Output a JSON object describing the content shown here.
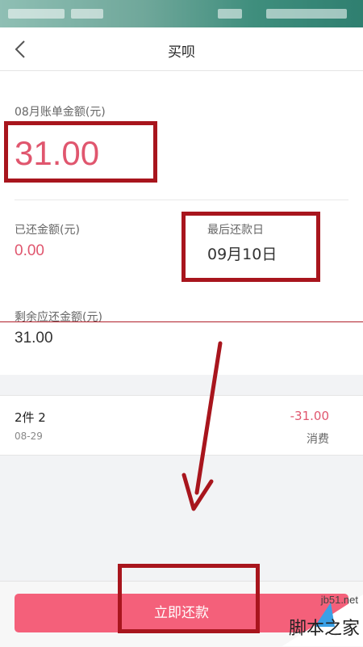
{
  "nav": {
    "title": "买呗",
    "back_icon": "chevron-left-icon"
  },
  "bill": {
    "month_label": "08月账单金额(元)",
    "amount": "31.00",
    "paid_label": "已还金额(元)",
    "paid_amount": "0.00",
    "due_label": "最后还款日",
    "due_date": "09月10日",
    "remaining_label": "剩余应还金额(元)",
    "remaining_amount": "31.00"
  },
  "transactions": [
    {
      "title": "2件 2",
      "date": "08-29",
      "amount": "-31.00",
      "type": "消费"
    }
  ],
  "action": {
    "pay_button": "立即还款"
  },
  "watermark": {
    "site": "jb51.net",
    "name": "脚本之家"
  },
  "colors": {
    "accent": "#e0566e",
    "button": "#f4607a",
    "annotation": "#a8151d"
  }
}
